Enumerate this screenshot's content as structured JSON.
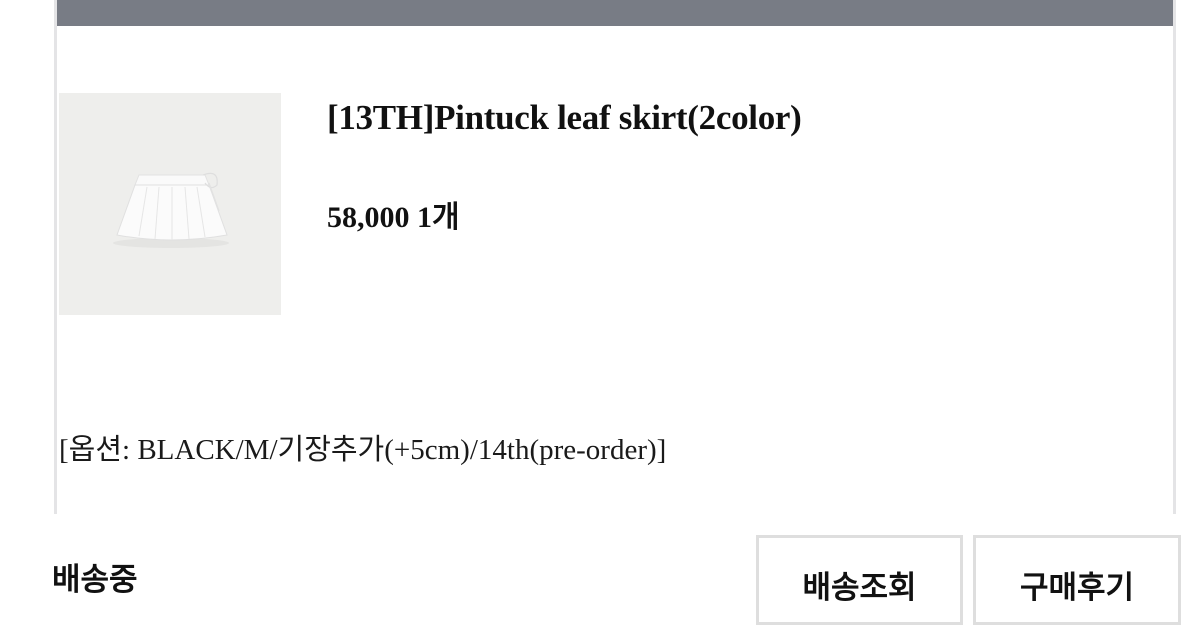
{
  "order": {
    "product": {
      "name": "[13TH]Pintuck leaf skirt(2color)",
      "price_qty": "58,000 1개",
      "image_icon": "product-thumbnail-white-skirt"
    },
    "option_text": "[옵션: BLACK/M/기장추가(+5cm)/14th(pre-order)]"
  },
  "delivery": {
    "status": "배송중"
  },
  "actions": {
    "track_label": "배송조회",
    "review_label": "구매후기"
  },
  "colors": {
    "header_bar": "#787c85",
    "border": "#e4e4e6",
    "text": "#111111"
  }
}
